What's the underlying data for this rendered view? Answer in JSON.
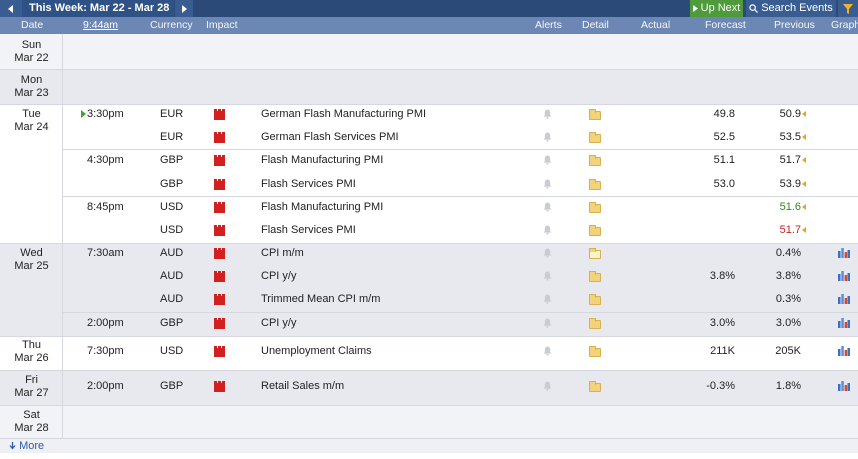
{
  "toolbar": {
    "title": "This Week: Mar 22 - Mar 28",
    "up_next": "Up Next",
    "search": "Search Events"
  },
  "header": {
    "date": "Date",
    "time": "9:44am",
    "currency": "Currency",
    "impact": "Impact",
    "alerts": "Alerts",
    "detail": "Detail",
    "actual": "Actual",
    "forecast": "Forecast",
    "previous": "Previous",
    "graph": "Graph"
  },
  "days": [
    {
      "day": "Sun",
      "date": "Mar 22"
    },
    {
      "day": "Mon",
      "date": "Mar 23"
    },
    {
      "day": "Tue",
      "date": "Mar 24"
    },
    {
      "day": "Wed",
      "date": "Mar 25"
    },
    {
      "day": "Thu",
      "date": "Mar 26"
    },
    {
      "day": "Fri",
      "date": "Mar 27"
    },
    {
      "day": "Sat",
      "date": "Mar 28"
    }
  ],
  "events": [
    {
      "time": "3:30pm",
      "currency": "EUR",
      "event": "German Flash Manufacturing PMI",
      "forecast": "49.8",
      "previous": "50.9",
      "prev_color": "normal"
    },
    {
      "time": "",
      "currency": "EUR",
      "event": "German Flash Services PMI",
      "forecast": "52.5",
      "previous": "53.5",
      "prev_color": "normal"
    },
    {
      "time": "4:30pm",
      "currency": "GBP",
      "event": "Flash Manufacturing PMI",
      "forecast": "51.1",
      "previous": "51.7",
      "prev_color": "normal"
    },
    {
      "time": "",
      "currency": "GBP",
      "event": "Flash Services PMI",
      "forecast": "53.0",
      "previous": "53.9",
      "prev_color": "normal"
    },
    {
      "time": "8:45pm",
      "currency": "USD",
      "event": "Flash Manufacturing PMI",
      "forecast": "",
      "previous": "51.6",
      "prev_color": "green"
    },
    {
      "time": "",
      "currency": "USD",
      "event": "Flash Services PMI",
      "forecast": "",
      "previous": "51.7",
      "prev_color": "red"
    },
    {
      "time": "7:30am",
      "currency": "AUD",
      "event": "CPI m/m",
      "forecast": "",
      "previous": "0.4%",
      "prev_color": "normal"
    },
    {
      "time": "",
      "currency": "AUD",
      "event": "CPI y/y",
      "forecast": "3.8%",
      "previous": "3.8%",
      "prev_color": "normal"
    },
    {
      "time": "",
      "currency": "AUD",
      "event": "Trimmed Mean CPI m/m",
      "forecast": "",
      "previous": "0.3%",
      "prev_color": "normal"
    },
    {
      "time": "2:00pm",
      "currency": "GBP",
      "event": "CPI y/y",
      "forecast": "3.0%",
      "previous": "3.0%",
      "prev_color": "normal"
    },
    {
      "time": "7:30pm",
      "currency": "USD",
      "event": "Unemployment Claims",
      "forecast": "211K",
      "previous": "205K",
      "prev_color": "normal"
    },
    {
      "time": "2:00pm",
      "currency": "GBP",
      "event": "Retail Sales m/m",
      "forecast": "-0.3%",
      "previous": "1.8%",
      "prev_color": "normal"
    }
  ],
  "footer": {
    "more": "More"
  },
  "colors": {
    "bar": "#2b4a78",
    "header": "#6c87b3",
    "up_next": "#4f9a3a",
    "impact_high": "#d0201f"
  }
}
